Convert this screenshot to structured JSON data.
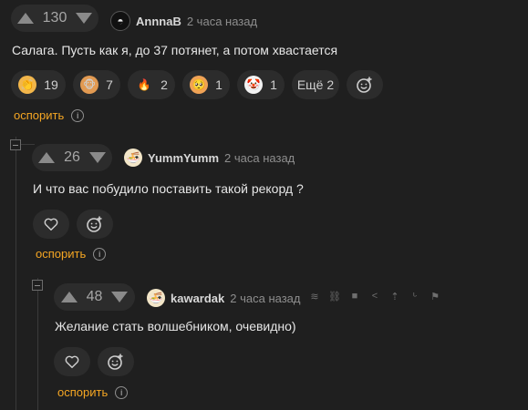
{
  "colors": {
    "bg": "#1f1f1f",
    "pill": "#2c2c2c",
    "accent": "#f5a623",
    "muted": "#8e8e8e",
    "text": "#e6e6e6"
  },
  "comments": [
    {
      "rating": "130",
      "author": "AnnnaB",
      "time": "2 часа назад",
      "avatar_icon": "dark-helmet-avatar-icon",
      "text": "Салага. Пусть как я, до 37 потянет, а потом хвастается",
      "reactions": [
        {
          "icon": "clapping-hands-icon",
          "count": "19"
        },
        {
          "icon": "monkey-face-icon",
          "count": "7"
        },
        {
          "icon": "fire-icon",
          "count": "2"
        },
        {
          "icon": "pleading-face-icon",
          "count": "1"
        },
        {
          "icon": "clown-face-icon",
          "count": "1"
        }
      ],
      "more_label": "Ещё 2",
      "reply_label": "оспорить"
    },
    {
      "rating": "26",
      "author": "YummYumm",
      "time": "2 часа назад",
      "avatar_icon": "food-avatar-icon",
      "text": "И что вас побудило поставить такой рекорд ?",
      "reply_label": "оспорить"
    },
    {
      "rating": "48",
      "author": "kawardak",
      "time": "2 часа назад",
      "avatar_icon": "food-avatar-icon",
      "text": "Желание стать волшебником, очевидно)",
      "reply_label": "оспорить"
    }
  ]
}
